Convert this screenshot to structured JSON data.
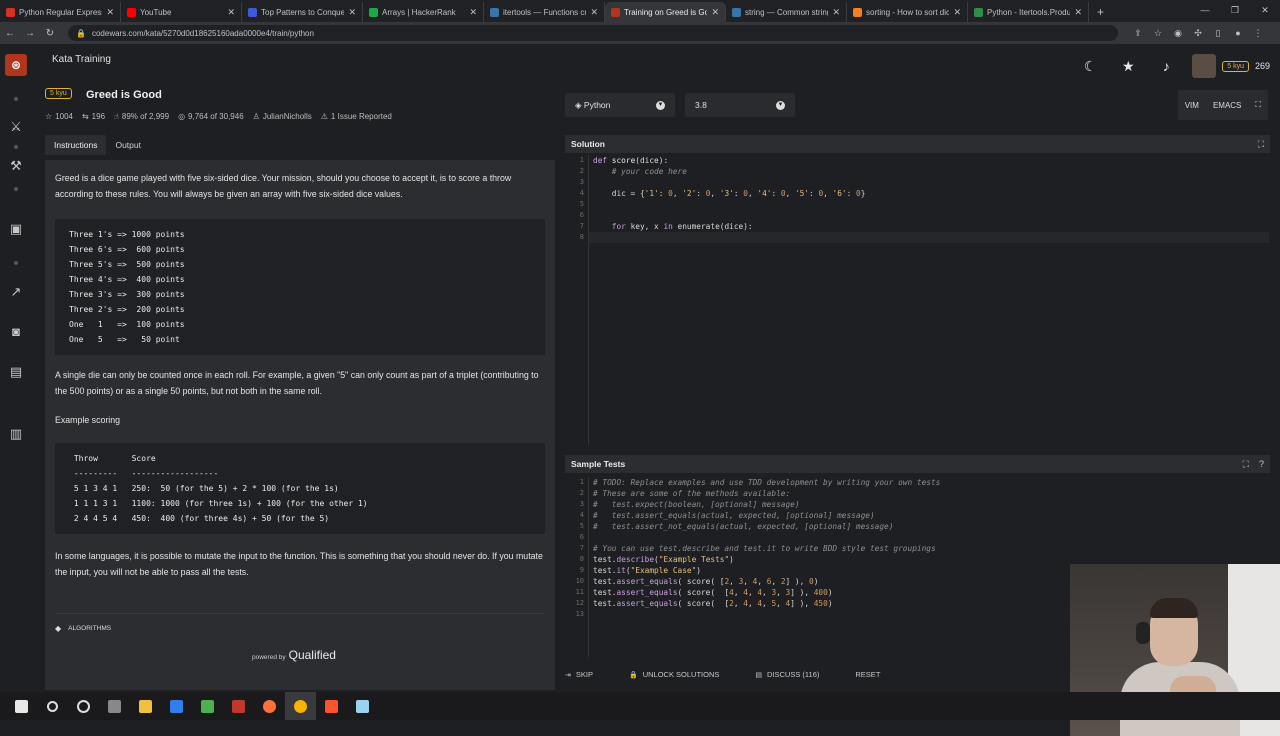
{
  "browser": {
    "tabs": [
      {
        "title": "Python Regular Expressio",
        "fav": "#d93025"
      },
      {
        "title": "YouTube",
        "fav": "#ff0000"
      },
      {
        "title": "Top Patterns to Conquer",
        "fav": "#3b5bdb"
      },
      {
        "title": "Arrays | HackerRank",
        "fav": "#1ba94c"
      },
      {
        "title": "itertools — Functions cre",
        "fav": "#3776ab"
      },
      {
        "title": "Training on Greed is Goo",
        "fav": "#b1361e",
        "active": true
      },
      {
        "title": "string — Common string",
        "fav": "#3776ab"
      },
      {
        "title": "sorting - How to sort dic",
        "fav": "#f48024"
      },
      {
        "title": "Python - Itertools.Produ",
        "fav": "#2f8d46"
      }
    ],
    "new_tab": "+",
    "url": "codewars.com/kata/5270d0d18625160ada0000e4/train/python"
  },
  "header": {
    "section_title": "Kata Training",
    "rank": "5 kyu",
    "honor": "269"
  },
  "kata": {
    "kyu": "5 kyu",
    "title": "Greed is Good",
    "stats": {
      "favorites": "1004",
      "votes": "196",
      "satisfaction": "89% of 2,999",
      "completed": "9,764 of 30,946",
      "author": "JulianNicholls",
      "issues": "1 Issue Reported"
    },
    "tabs": [
      "Instructions",
      "Output"
    ],
    "intro": "Greed is a dice game played with five six-sided dice. Your mission, should you choose to accept it, is to score a throw according to these rules. You will always be given an array with five six-sided dice values.",
    "rules": [
      "Three 1's => 1000 points",
      "Three 6's =>  600 points",
      "Three 5's =>  500 points",
      "Three 4's =>  400 points",
      "Three 3's =>  300 points",
      "Three 2's =>  200 points",
      "One   1   =>  100 points",
      "One   5   =>   50 point"
    ],
    "single_die": "A single die can only be counted once in each roll. For example, a given \"5\" can only count as part of a triplet (contributing to the 500 points) or as a single 50 points, but not both in the same roll.",
    "example_heading": "Example scoring",
    "example": [
      " Throw       Score",
      " ---------   ------------------",
      " 5 1 3 4 1   250:  50 (for the 5) + 2 * 100 (for the 1s)",
      " 1 1 1 3 1   1100: 1000 (for three 1s) + 100 (for the other 1)",
      " 2 4 4 5 4   450:  400 (for three 4s) + 50 (for the 5)"
    ],
    "mutate": "In some languages, it is possible to mutate the input to the function. This is something that you should never do. If you mutate the input, you will not be able to pass all the tests.",
    "tag": "ALGORITHMS",
    "powered_by": "powered by",
    "qualified": "Qualified"
  },
  "editor": {
    "language": "Python",
    "version": "3.8",
    "modes": [
      "VIM",
      "EMACS"
    ],
    "solution_title": "Solution",
    "tests_title": "Sample Tests"
  },
  "footer": {
    "skip": "SKIP",
    "unlock": "UNLOCK SOLUTIONS",
    "discuss": "DISCUSS (116)",
    "reset": "RESET"
  }
}
